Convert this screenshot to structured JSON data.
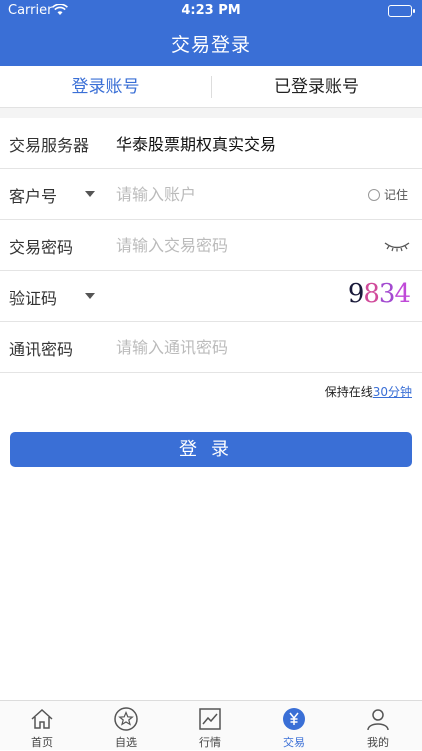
{
  "status_bar": {
    "carrier": "Carrier",
    "time": "4:23 PM"
  },
  "nav": {
    "title": "交易登录"
  },
  "tabs": [
    {
      "label": "登录账号",
      "active": true
    },
    {
      "label": "已登录账号",
      "active": false
    }
  ],
  "form": {
    "server": {
      "label": "交易服务器",
      "value": "华泰股票期权真实交易"
    },
    "account": {
      "label": "客户号",
      "placeholder": "请输入账户",
      "remember_label": "记住"
    },
    "password": {
      "label": "交易密码",
      "placeholder": "请输入交易密码"
    },
    "captcha": {
      "label": "验证码",
      "digits": [
        "9",
        "8",
        "3",
        "4"
      ]
    },
    "comm_password": {
      "label": "通讯密码",
      "placeholder": "请输入通讯密码"
    }
  },
  "stay_online": {
    "prefix": "保持在线",
    "duration": "30分钟"
  },
  "login_button": {
    "label": "登录"
  },
  "tabbar": [
    {
      "label": "首页",
      "icon": "home-icon"
    },
    {
      "label": "自选",
      "icon": "star-icon"
    },
    {
      "label": "行情",
      "icon": "chart-icon"
    },
    {
      "label": "交易",
      "icon": "yen-icon",
      "active": true
    },
    {
      "label": "我的",
      "icon": "person-icon"
    }
  ],
  "colors": {
    "accent": "#3a6fd6",
    "background": "#ffffff"
  }
}
